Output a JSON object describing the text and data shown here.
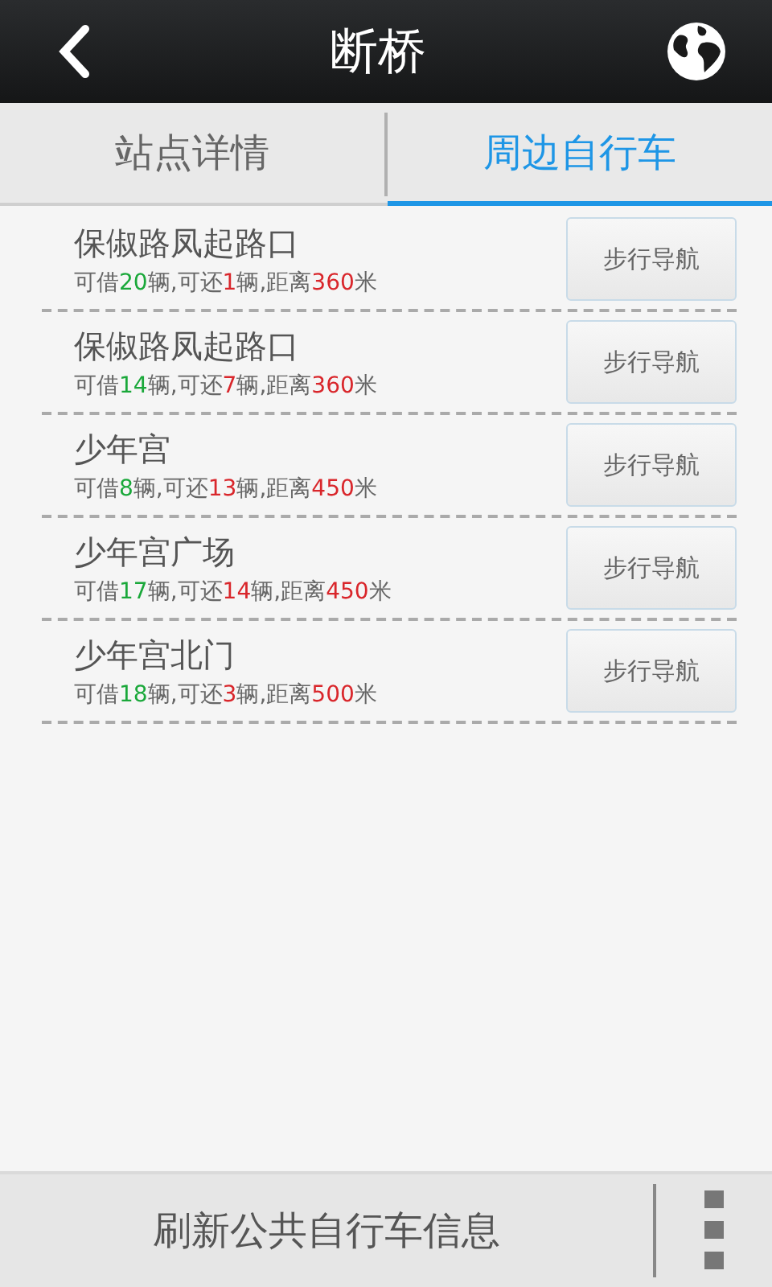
{
  "header": {
    "title": "断桥"
  },
  "tabs": [
    {
      "label": "站点详情",
      "selected": false
    },
    {
      "label": "周边自行车",
      "selected": true
    }
  ],
  "stations": [
    {
      "name": "保俶路凤起路口",
      "info": [
        {
          "kind": "text",
          "text": "可借"
        },
        {
          "kind": "borrow",
          "text": "20"
        },
        {
          "kind": "text",
          "text": "辆,可还"
        },
        {
          "kind": "return",
          "text": "1"
        },
        {
          "kind": "text",
          "text": "辆,距离"
        },
        {
          "kind": "distance",
          "text": "360"
        },
        {
          "kind": "text",
          "text": "米"
        }
      ],
      "button": "步行导航"
    },
    {
      "name": "保俶路凤起路口",
      "info": [
        {
          "kind": "text",
          "text": "可借"
        },
        {
          "kind": "borrow",
          "text": "14"
        },
        {
          "kind": "text",
          "text": "辆,可还"
        },
        {
          "kind": "return",
          "text": "7"
        },
        {
          "kind": "text",
          "text": "辆,距离"
        },
        {
          "kind": "distance",
          "text": "360"
        },
        {
          "kind": "text",
          "text": "米"
        }
      ],
      "button": "步行导航"
    },
    {
      "name": "少年宫",
      "info": [
        {
          "kind": "text",
          "text": "可借"
        },
        {
          "kind": "borrow",
          "text": "8"
        },
        {
          "kind": "text",
          "text": "辆,可还"
        },
        {
          "kind": "return",
          "text": "13"
        },
        {
          "kind": "text",
          "text": "辆,距离"
        },
        {
          "kind": "distance",
          "text": "450"
        },
        {
          "kind": "text",
          "text": "米"
        }
      ],
      "button": "步行导航"
    },
    {
      "name": "少年宫广场",
      "info": [
        {
          "kind": "text",
          "text": "可借"
        },
        {
          "kind": "borrow",
          "text": "17"
        },
        {
          "kind": "text",
          "text": "辆,可还"
        },
        {
          "kind": "return",
          "text": "14"
        },
        {
          "kind": "text",
          "text": "辆,距离"
        },
        {
          "kind": "distance",
          "text": "450"
        },
        {
          "kind": "text",
          "text": "米"
        }
      ],
      "button": "步行导航"
    },
    {
      "name": "少年宫北门",
      "info": [
        {
          "kind": "text",
          "text": "可借"
        },
        {
          "kind": "borrow",
          "text": "18"
        },
        {
          "kind": "text",
          "text": "辆,可还"
        },
        {
          "kind": "return",
          "text": "3"
        },
        {
          "kind": "text",
          "text": "辆,距离"
        },
        {
          "kind": "distance",
          "text": "500"
        },
        {
          "kind": "text",
          "text": "米"
        }
      ],
      "button": "步行导航"
    }
  ],
  "bottom_bar": {
    "button": "刷新公共自行车信息"
  }
}
